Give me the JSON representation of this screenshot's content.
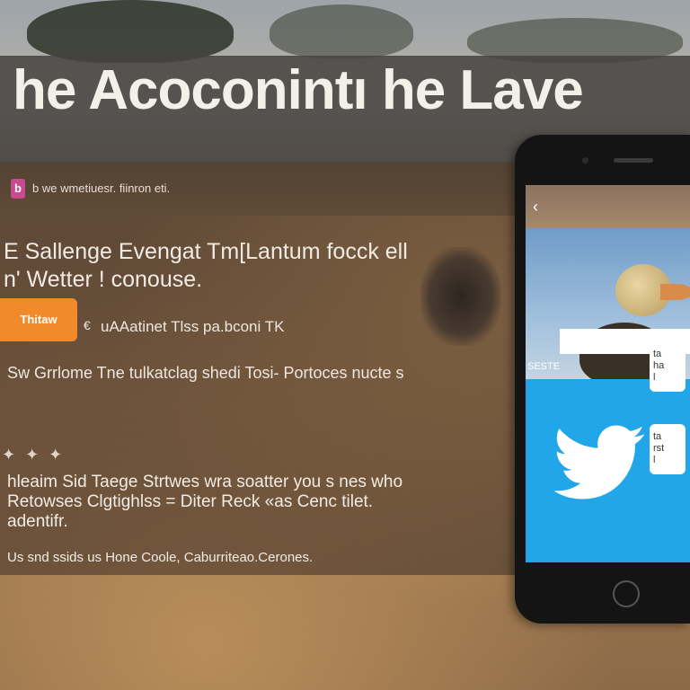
{
  "banner": {
    "title": "he Acoconintı he Lave"
  },
  "header": {
    "brand_icon": "b",
    "brand_line": "b we wmetiuesr. fiinron eti."
  },
  "hero": {
    "line1": "E Sallenge Evengat Tm[Lantum focck ell",
    "line2": "n'  Wetter !  conouse."
  },
  "cta": {
    "button_label": "Thitaw",
    "side_icon": "€",
    "side_text": "uAAatinet Tlss pa.bconi TK"
  },
  "subtitle": "Sw Grrlome   Tne tulkatclag shedi Tosi- Portoces nucte s",
  "rating": {
    "stars": "✦ ✦ ✦"
  },
  "paragraph": {
    "line1": "hleaim Sid  Taege Strtwes wra soatter you s nes who",
    "line2": "Retowses Clgtighlss = Diter Reck «as Cenc tilet.",
    "line3": "adentifr."
  },
  "footer": "Us snd ssids us Hone Coole, Caburriteao.Cerones.",
  "phone": {
    "back_icon": "‹",
    "caption": "SESTE",
    "card1": "ta\nha\nl",
    "card2": "ta\nrst\nl"
  },
  "colors": {
    "accent": "#f08a2a",
    "twitter": "#21a6ea",
    "banner": "#46423f"
  },
  "icons": [
    "brand-icon",
    "back-icon",
    "twitter-bird-icon",
    "home-button-icon",
    "star-icon"
  ]
}
